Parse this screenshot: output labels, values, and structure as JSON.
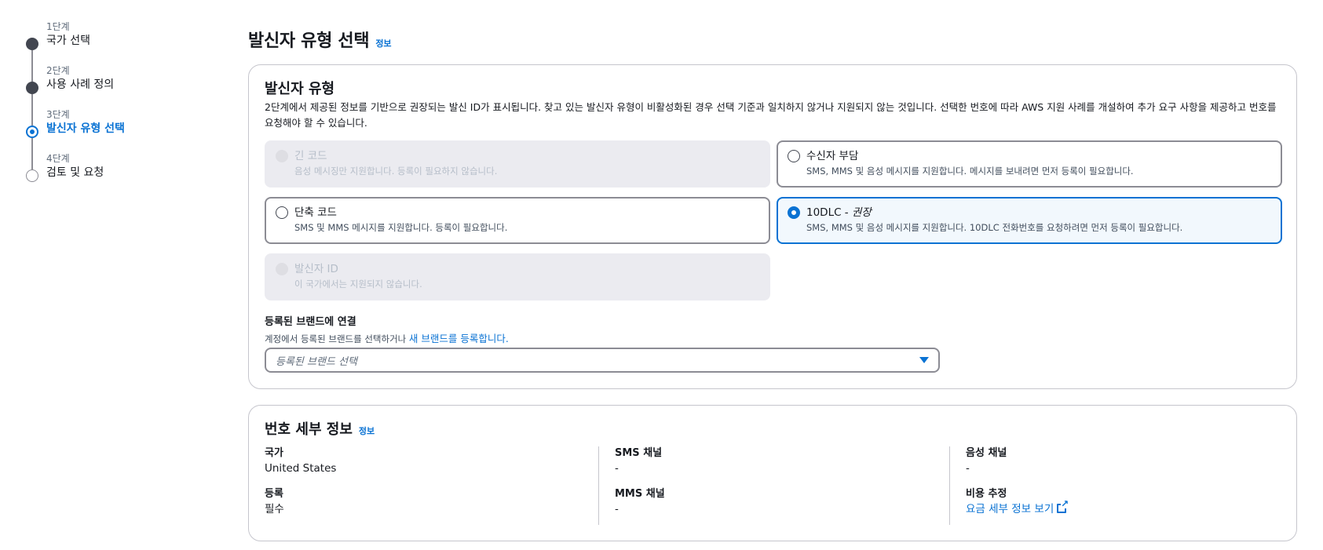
{
  "steps": [
    {
      "num": "1단계",
      "title": "국가 선택"
    },
    {
      "num": "2단계",
      "title": "사용 사례 정의"
    },
    {
      "num": "3단계",
      "title": "발신자 유형 선택"
    },
    {
      "num": "4단계",
      "title": "검토 및 요청"
    }
  ],
  "page": {
    "title": "발신자 유형 선택",
    "info": "정보"
  },
  "origination": {
    "title": "발신자 유형",
    "description": "2단계에서 제공된 정보를 기반으로 권장되는 발신 ID가 표시됩니다. 찾고 있는 발신자 유형이 비활성화된 경우 선택 기준과 일치하지 않거나 지원되지 않는 것입니다. 선택한 번호에 따라 AWS 지원 사례를 개설하여 추가 요구 사항을 제공하고 번호를 요청해야 할 수 있습니다.",
    "tiles": {
      "long_code": {
        "label": "긴 코드",
        "desc": "음성 메시징만 지원합니다. 등록이 필요하지 않습니다."
      },
      "toll_free": {
        "label": "수신자 부담",
        "desc": "SMS, MMS 및 음성 메시지를 지원합니다. 메시지를 보내려면 먼저 등록이 필요합니다."
      },
      "short_code": {
        "label": "단축 코드",
        "desc": "SMS 및 MMS 메시지를 지원합니다. 등록이 필요합니다."
      },
      "ten_dlc": {
        "label": "10DLC - ",
        "label_em": "권장",
        "desc": "SMS, MMS 및 음성 메시지를 지원합니다. 10DLC 전화번호를 요청하려면 먼저 등록이 필요합니다."
      },
      "sender_id": {
        "label": "발신자 ID",
        "desc": "이 국가에서는 지원되지 않습니다."
      }
    },
    "brand": {
      "label": "등록된 브랜드에 연결",
      "desc": "계정에서 등록된 브랜드를 선택하거나 ",
      "link": "새 브랜드를 등록합니다.",
      "placeholder": "등록된 브랜드 선택"
    }
  },
  "details": {
    "title": "번호 세부 정보",
    "info": "정보",
    "country_label": "국가",
    "country_value": "United States",
    "registration_label": "등록",
    "registration_value": "필수",
    "sms_label": "SMS 채널",
    "sms_value": "-",
    "mms_label": "MMS 채널",
    "mms_value": "-",
    "voice_label": "음성 채널",
    "voice_value": "-",
    "cost_label": "비용 추정",
    "cost_link": "요금 세부 정보 보기"
  },
  "colors": {
    "accent": "#0972d3",
    "selected_bg": "#f2f8fd",
    "disabled_bg": "#ebebf0"
  }
}
